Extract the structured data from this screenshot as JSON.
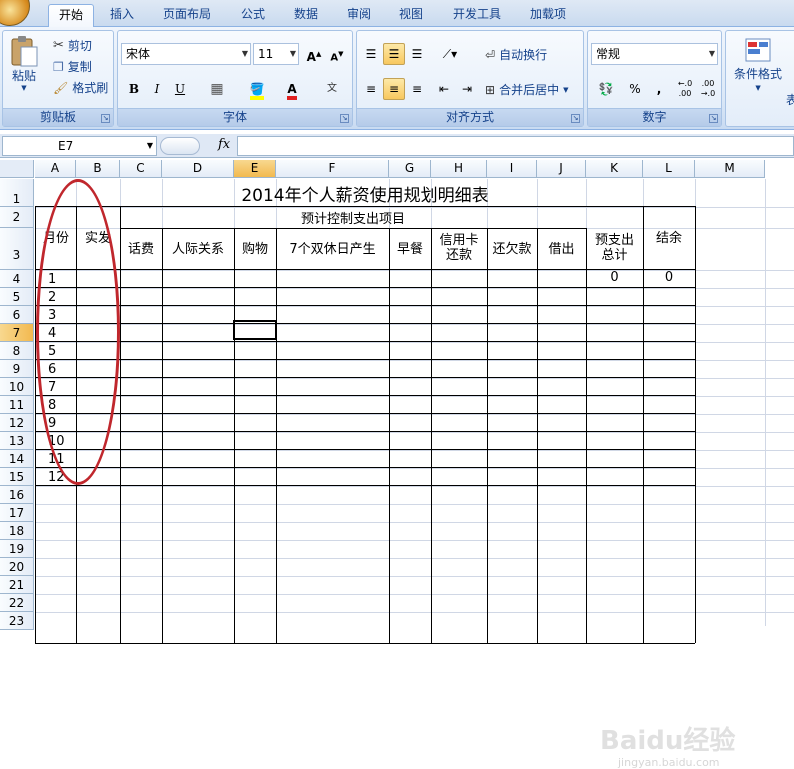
{
  "ribbon_tabs": [
    "开始",
    "插入",
    "页面布局",
    "公式",
    "数据",
    "审阅",
    "视图",
    "开发工具",
    "加载项"
  ],
  "active_tab": "开始",
  "clipboard": {
    "paste": "粘贴",
    "cut": "剪切",
    "copy": "复制",
    "format_painter": "格式刷",
    "label": "剪贴板"
  },
  "font": {
    "name": "宋体",
    "size": "11",
    "label": "字体",
    "bold": "B",
    "italic": "I",
    "underline": "U"
  },
  "alignment": {
    "wrap_text": "自动换行",
    "merge_center": "合并后居中",
    "label": "对齐方式"
  },
  "number": {
    "format": "常规",
    "label": "数字",
    "percent": "%",
    "comma": ","
  },
  "styles": {
    "conditional_format": "条件格式",
    "table_format_partial": "表"
  },
  "formula_bar": {
    "name_box": "E7",
    "fx": "fx",
    "content": ""
  },
  "columns": [
    "A",
    "B",
    "C",
    "D",
    "E",
    "F",
    "G",
    "H",
    "I",
    "J",
    "K",
    "L",
    "M"
  ],
  "rows": [
    "1",
    "2",
    "3",
    "4",
    "5",
    "6",
    "7",
    "8",
    "9",
    "10",
    "11",
    "12",
    "13",
    "14",
    "15",
    "16",
    "17",
    "18",
    "19",
    "20",
    "21",
    "22",
    "23"
  ],
  "selected_column": "E",
  "selected_row": "7",
  "sheet": {
    "title": "2014年个人薪资使用规划明细表",
    "month_header": "月份",
    "income_header": "实发",
    "expense_group_header": "预计控制支出项目",
    "expense_columns": [
      "话费",
      "人际关系",
      "购物",
      "7个双休日产生",
      "早餐",
      "信用卡还款",
      "还欠款",
      "借出"
    ],
    "total_header": "预支出总计",
    "balance_header": "结余",
    "months": [
      "1",
      "2",
      "3",
      "4",
      "5",
      "6",
      "7",
      "8",
      "9",
      "10",
      "11",
      "12"
    ],
    "first_total": "0",
    "first_balance": "0"
  },
  "watermark": {
    "text": "Baidu经验",
    "url": "jingyan.baidu.com"
  },
  "accent_colors": {
    "ribbon_blue": "#15428b",
    "highlight": "#f8c85f",
    "annotation_red": "#c0272d"
  }
}
